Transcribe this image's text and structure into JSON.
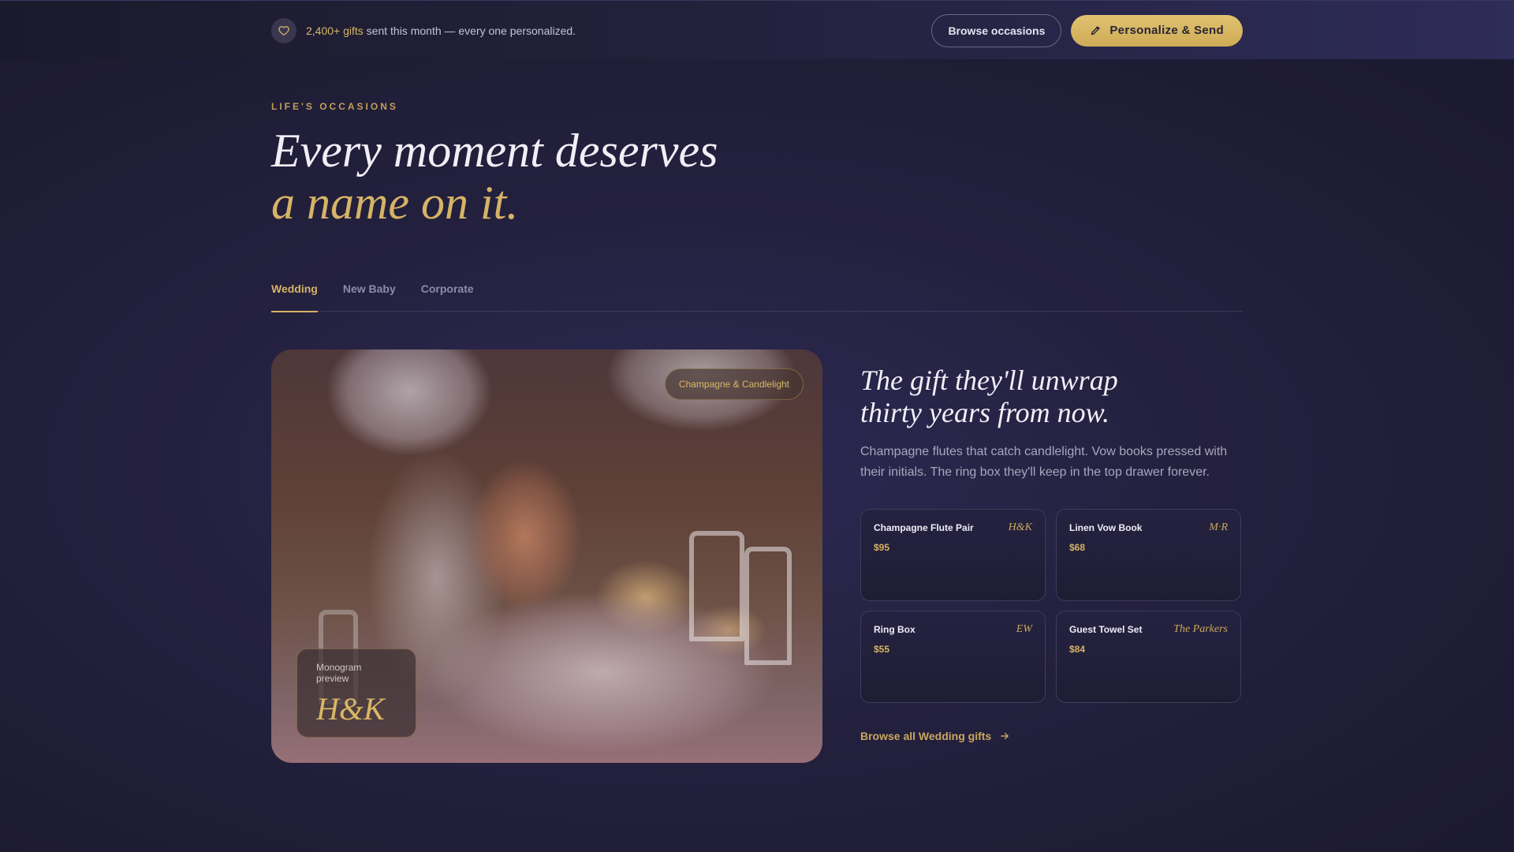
{
  "topbar": {
    "announce_highlight": "2,400+ gifts",
    "announce_rest": " sent this month — every one personalized.",
    "browse_label": "Browse occasions",
    "personalize_label": "Personalize & Send"
  },
  "hero": {
    "eyebrow": "LIFE'S OCCASIONS",
    "headline_line1": "Every moment deserves",
    "headline_line2": "a name on it."
  },
  "tabs": [
    {
      "label": "Wedding",
      "active": true
    },
    {
      "label": "New Baby",
      "active": false
    },
    {
      "label": "Corporate",
      "active": false
    }
  ],
  "feature": {
    "photo_tag": "Champagne & Candlelight",
    "monogram_label": "Monogram preview",
    "monogram_value": "H&K",
    "pitch_line1": "The gift they'll unwrap",
    "pitch_line2": "thirty years from now.",
    "description": "Champagne flutes that catch candlelight. Vow books pressed with their initials. The ring box they'll keep in the top drawer forever.",
    "browse_all_label": "Browse all Wedding gifts"
  },
  "products": [
    {
      "name": "Champagne Flute Pair",
      "price": "$95",
      "mark": "H&K"
    },
    {
      "name": "Linen Vow Book",
      "price": "$68",
      "mark": "M·R"
    },
    {
      "name": "Ring Box",
      "price": "$55",
      "mark": "EW"
    },
    {
      "name": "Guest Towel Set",
      "price": "$84",
      "mark": "The Parkers"
    }
  ],
  "colors": {
    "accent_gold": "#d6b366",
    "background": "#24213f",
    "text_light": "#f2eef6"
  },
  "icons": {
    "announce": "heart-icon",
    "personalize": "pencil-icon",
    "browse_all": "arrow-right-icon"
  }
}
